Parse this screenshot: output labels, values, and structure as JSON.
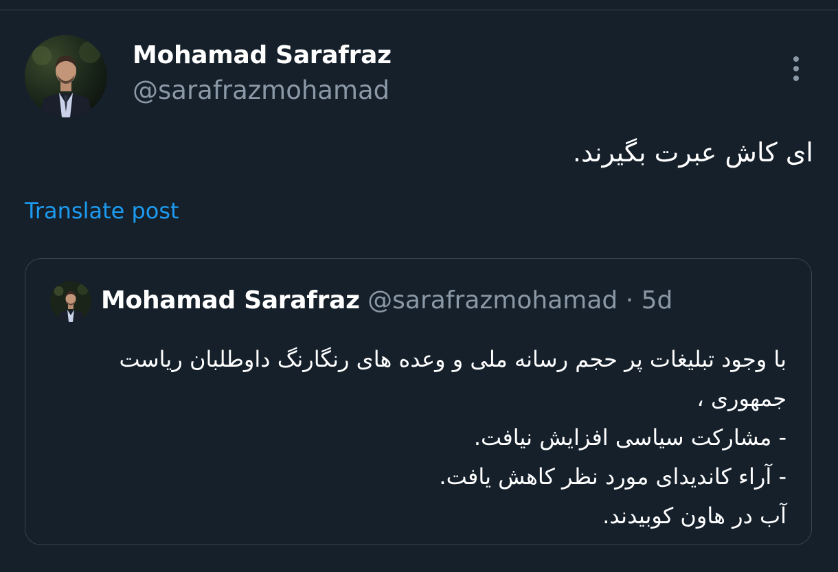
{
  "post": {
    "author": {
      "name": "Mohamad Sarafraz",
      "handle": "@sarafrazmohamad"
    },
    "text": "ای کاش عبرت بگیرند.",
    "translate_label": "Translate post"
  },
  "quoted": {
    "author": {
      "name": "Mohamad Sarafraz",
      "handle": "@sarafrazmohamad"
    },
    "separator": "·",
    "time": "5d",
    "lines": [
      "با وجود تبلیغات پر حجم رسانه ملی و وعده های رنگارنگ داوطلبان ریاست",
      "جمهوری ،",
      "- مشارکت سیاسی افزایش نیافت.",
      "- آراء کاندیدای مورد نظر کاهش یافت.",
      "آب در هاون کوبیدند."
    ]
  },
  "icons": {
    "more": "more-vertical-icon"
  },
  "colors": {
    "background": "#15202b",
    "primary_text": "#ffffff",
    "secondary_text": "#8b98a5",
    "link": "#1d9bf0",
    "border": "#38444d"
  }
}
